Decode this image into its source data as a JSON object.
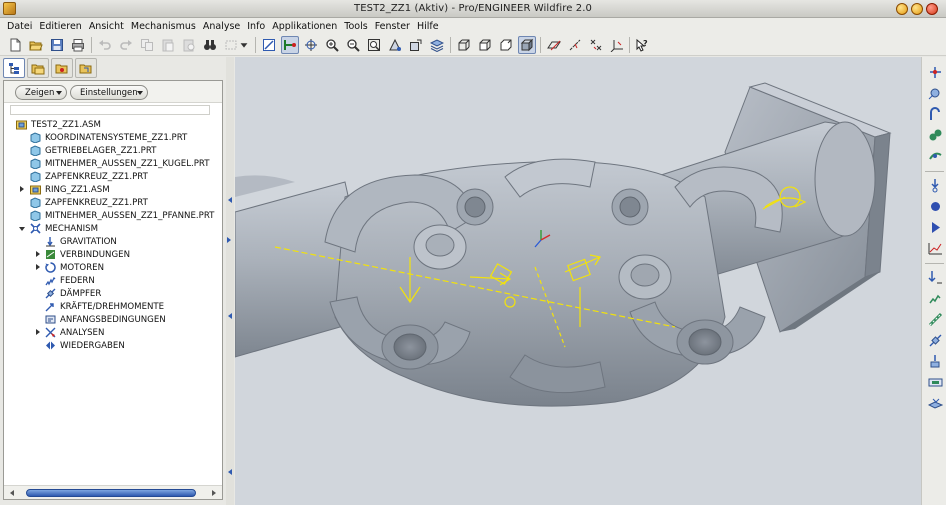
{
  "window": {
    "title": "TEST2_ZZ1 (Aktiv) - Pro/ENGINEER Wildfire 2.0"
  },
  "menu": [
    {
      "label": "Datei"
    },
    {
      "label": "Editieren"
    },
    {
      "label": "Ansicht"
    },
    {
      "label": "Mechanismus"
    },
    {
      "label": "Analyse"
    },
    {
      "label": "Info"
    },
    {
      "label": "Applikationen"
    },
    {
      "label": "Tools"
    },
    {
      "label": "Fenster"
    },
    {
      "label": "Hilfe"
    }
  ],
  "toolbar": {
    "icons": [
      "new-icon",
      "open-icon",
      "save-icon",
      "print-icon",
      "undo-icon",
      "redo-icon",
      "copy-icon",
      "paste-icon",
      "paste-special-icon",
      "binoculars-icon",
      "select-box-icon",
      "dropdown-icon",
      "regenerate-icon",
      "mechanism-connection-icon",
      "spin-center-icon",
      "zoom-in-icon",
      "zoom-out-icon",
      "refit-icon",
      "orient-icon",
      "saved-views-icon",
      "layers-icon",
      "wireframe-icon",
      "hidden-line-icon",
      "no-hidden-icon",
      "shading-icon",
      "datum-planes-icon",
      "datum-axes-icon",
      "datum-points-icon",
      "coordinate-systems-icon",
      "context-help-icon"
    ]
  },
  "nav_tabs": [
    "model-tree-tab",
    "folder-browser-tab",
    "favorites-tab",
    "connections-tab"
  ],
  "model_tree": {
    "show_button": "Zeigen",
    "settings_button": "Einstellungen",
    "items": [
      {
        "label": "TEST2_ZZ1.ASM",
        "icon": "assembly-icon",
        "level": 0
      },
      {
        "label": "KOORDINATENSYSTEME_ZZ1.PRT",
        "icon": "part-icon",
        "level": 1
      },
      {
        "label": "GETRIEBELAGER_ZZ1.PRT",
        "icon": "part-icon",
        "level": 1
      },
      {
        "label": "MITNEHMER_AUSSEN_ZZ1_KUGEL.PRT",
        "icon": "part-icon",
        "level": 1
      },
      {
        "label": "ZAPFENKREUZ_ZZ1.PRT",
        "icon": "part-icon",
        "level": 1
      },
      {
        "label": "RING_ZZ1.ASM",
        "icon": "assembly-icon",
        "level": 1
      },
      {
        "label": "ZAPFENKREUZ_ZZ1.PRT",
        "icon": "part-icon",
        "level": 1
      },
      {
        "label": "MITNEHMER_AUSSEN_ZZ1_PFANNE.PRT",
        "icon": "part-icon",
        "level": 1
      },
      {
        "label": "MECHANISM",
        "icon": "mechanism-icon",
        "level": 0
      },
      {
        "label": "GRAVITATION",
        "icon": "gravity-icon",
        "level": 1
      },
      {
        "label": "VERBINDUNGEN",
        "icon": "connections-icon",
        "level": 1
      },
      {
        "label": "MOTOREN",
        "icon": "motors-icon",
        "level": 1
      },
      {
        "label": "FEDERN",
        "icon": "springs-icon",
        "level": 1
      },
      {
        "label": "DÄMPFER",
        "icon": "dampers-icon",
        "level": 1
      },
      {
        "label": "KRÄFTE/DREHMOMENTE",
        "icon": "forces-icon",
        "level": 1
      },
      {
        "label": "ANFANGSBEDINGUNGEN",
        "icon": "initial-conditions-icon",
        "level": 1
      },
      {
        "label": "ANALYSEN",
        "icon": "analyses-icon",
        "level": 1
      },
      {
        "label": "WIEDERGABEN",
        "icon": "playbacks-icon",
        "level": 1
      }
    ]
  },
  "viewport": {
    "model": "universal-joint-assembly",
    "background": "#d1d6dc"
  },
  "right_toolbar": {
    "icons": [
      "drag-components-icon",
      "connect-icon",
      "gear-pair-icon",
      "cam-icon",
      "slot-icon",
      "servo-motor-icon",
      "mechanism-analysis-icon",
      "run-analysis-icon",
      "playback-icon",
      "measure-results-icon",
      "gravity-tool-icon",
      "spring-tool-icon",
      "damper-tool-icon",
      "force-torque-tool-icon",
      "initial-condition-tool-icon",
      "mass-properties-icon",
      "model-info-icon"
    ]
  },
  "colors": {
    "model_gray": "#a7adb5",
    "datum_yellow": "#f2e20c",
    "accent_blue": "#2f5ab0"
  }
}
